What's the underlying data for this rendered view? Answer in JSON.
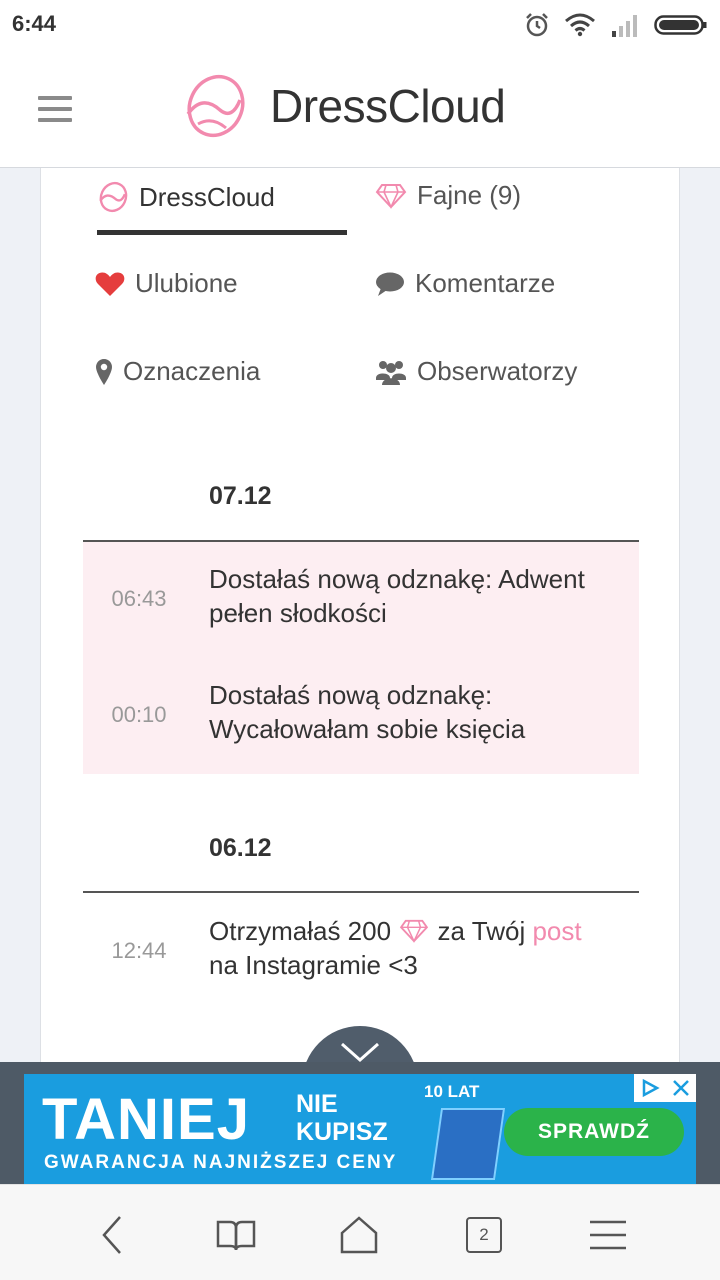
{
  "status_bar": {
    "time": "6:44"
  },
  "header": {
    "brand": "DressCloud"
  },
  "tabs": [
    {
      "label": "DressCloud",
      "icon": "dresscloud-logo-icon",
      "active": true
    },
    {
      "label": "Fajne (9)",
      "icon": "diamond-icon",
      "active": false
    },
    {
      "label": "Ulubione",
      "icon": "heart-icon",
      "active": false
    },
    {
      "label": "Komentarze",
      "icon": "comment-icon",
      "active": false
    },
    {
      "label": "Oznaczenia",
      "icon": "map-pin-icon",
      "active": false
    },
    {
      "label": "Obserwatorzy",
      "icon": "users-icon",
      "active": false
    }
  ],
  "feed": [
    {
      "date": "07.12",
      "entries": [
        {
          "time": "06:43",
          "text": "Dostałaś nową odznakę: Adwent pełen słodkości",
          "highlighted": true
        },
        {
          "time": "00:10",
          "text": "Dostałaś nową odznakę: Wycałowałam sobie księcia",
          "highlighted": true
        }
      ]
    },
    {
      "date": "06.12",
      "entries": [
        {
          "time": "12:44",
          "text_before": "Otrzymałaś 200",
          "text_middle": "za Twój",
          "link": "post",
          "text_after": "na Instagramie <3",
          "highlighted": false
        }
      ]
    }
  ],
  "ad": {
    "headline": "TANIEJ",
    "headline_side_1": "NIE",
    "headline_side_2": "KUPISZ",
    "subline": "GWARANCJA NAJNIŻSZEJ CENY",
    "badge": "10 LAT",
    "cta": "SPRAWDŹ"
  },
  "navbar": {
    "tab_count": "2"
  },
  "colors": {
    "accent_pink": "#f28aae",
    "highlight_bg": "#fdeef2",
    "ad_blue": "#1a9ddf",
    "ad_green": "#2bb34a"
  }
}
